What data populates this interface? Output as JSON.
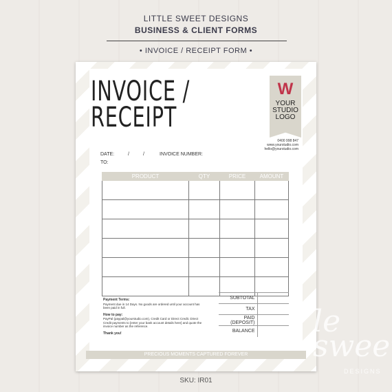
{
  "header": {
    "brand": "LITTLE SWEET DESIGNS",
    "subtitle": "BUSINESS & CLIENT FORMS",
    "form_name": "• INVOICE / RECEIPT FORM •"
  },
  "form": {
    "title_line1": "INVOICE /",
    "title_line2": "RECEIPT",
    "logo": {
      "mark": "W",
      "text": "YOUR STUDIO LOGO",
      "accent": "#c0344a"
    },
    "contact": [
      "0400 998 847",
      "www.yourstudio.com",
      "hello@yourstudio.com"
    ],
    "date_label": "DATE:",
    "date_sep1": "/",
    "date_sep2": "/",
    "invoice_number_label": "INVOICE NUMBER:",
    "to_label": "TO:",
    "columns": [
      "PRODUCT",
      "QTY",
      "PRICE",
      "AMOUNT"
    ],
    "totals": [
      "SUBTOTAL",
      "TAX",
      "PAID (DEPOSIT)",
      "BALANCE"
    ],
    "payment_terms_title": "Payment Terms:",
    "payment_terms": "Payment due in 14 Days. No goods are ordered until your account has been paid in full.",
    "how_to_pay_title": "How to pay:",
    "how_to_pay": "PayPal (paypal@yourstudio.com), Credit Card or Direct Credit. Direct Credit payments to [enter your bank account details here] and quote the invoice number as the reference.",
    "thanks": "Thank you!",
    "banner": "PRECIOUS MOMENTS CAPTURED FOREVER"
  },
  "sku": "SKU: IR01",
  "watermark": {
    "text": "le sweet",
    "sub": "DESIGNS"
  }
}
